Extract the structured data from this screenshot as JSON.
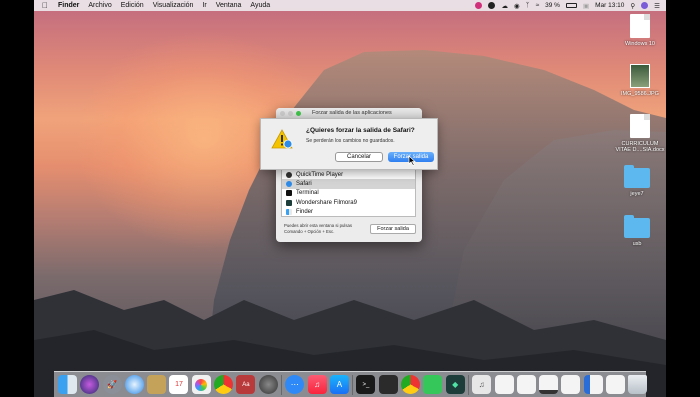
{
  "menubar": {
    "app": "Finder",
    "items": [
      "Archivo",
      "Edición",
      "Visualización",
      "Ir",
      "Ventana",
      "Ayuda"
    ],
    "battery": "39 %",
    "clock": "Mar 13:10"
  },
  "desktop_icons": [
    {
      "label": "Windows 10",
      "icon": "document-icon"
    },
    {
      "label": "IMG_9586.JPG",
      "icon": "photo-icon"
    },
    {
      "label_line1": "CURRICULUM",
      "label_line2": "VITAE D....SIA.docx",
      "icon": "docx-icon"
    },
    {
      "label": "jeye7",
      "icon": "folder-icon"
    },
    {
      "label": "usb",
      "icon": "folder-icon"
    }
  ],
  "force_quit": {
    "title": "Forzar salida de las aplicaciones",
    "apps": [
      "QuickTime Player",
      "Safari",
      "Terminal",
      "Wondershare Filmora9",
      "Finder"
    ],
    "selected": "Safari",
    "hint_line1": "Puedes abrir esta ventana si pulsas",
    "hint_line2": "Comando + Opción + Esc.",
    "button": "Forzar salida"
  },
  "alert": {
    "title": "¿Quieres forzar la salida de Safari?",
    "message": "Se perderán los cambios no guardados.",
    "cancel": "Cancelar",
    "confirm": "Forzar salida"
  },
  "colors": {
    "accent": "#2f7ff0",
    "menubar": "#ebe8eb",
    "sheet": "#eeeeee"
  },
  "dock_icons": [
    "finder-icon",
    "siri-icon",
    "launchpad-icon",
    "safari-icon",
    "notes-icon",
    "calendar-icon",
    "photos-icon",
    "chrome-icon",
    "dictionary-icon",
    "quicktime-icon",
    "messages-icon",
    "music-icon",
    "appstore-icon",
    "terminal-icon",
    "screenshot-icon",
    "chrome2-icon",
    "facetime-icon",
    "filmora-icon",
    "document1-icon",
    "document2-icon",
    "document3-icon",
    "document4-icon",
    "document5-icon",
    "document6-icon",
    "document7-icon",
    "trash-icon"
  ]
}
